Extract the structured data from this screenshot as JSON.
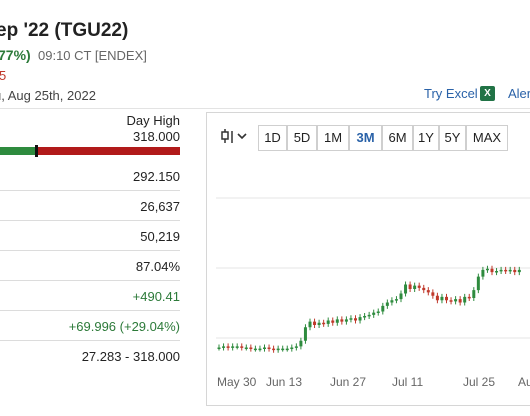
{
  "header": {
    "title": "ep '22 (TGU22)",
    "change_pct": "77%)",
    "time": "09:10 CT [ENDEX]",
    "line3": "5",
    "date": "u, Aug 25th, 2022"
  },
  "links": {
    "try_excel": "Try Excel",
    "alerts": "Aler",
    "excel_icon_text": "X"
  },
  "stats": {
    "day_high_label": "Day High",
    "day_high_value": "318.000",
    "rows": [
      {
        "value": "292.150",
        "color": "default"
      },
      {
        "value": "26,637",
        "color": "default"
      },
      {
        "value": "50,219",
        "color": "default"
      },
      {
        "value": "87.04%",
        "color": "default"
      },
      {
        "value": "+490.41",
        "color": "green"
      },
      {
        "value": "+69.996 (+29.04%)",
        "color": "green"
      },
      {
        "value": "27.283 - 318.000",
        "color": "default"
      }
    ]
  },
  "toolbar": {
    "chart_type_icon": "candlestick-icon",
    "ranges": [
      "1D",
      "5D",
      "1M",
      "3M",
      "6M",
      "1Y",
      "5Y",
      "MAX"
    ],
    "active_range": "3M"
  },
  "chart_data": {
    "type": "candlestick",
    "x_tick_labels": [
      "May 30",
      "Jun 13",
      "Jun 27",
      "Jul 11",
      "Jul 25",
      "Au"
    ],
    "grid": true,
    "colors": {
      "up": "#2e8b3e",
      "down": "#c0392b"
    },
    "candles_approx_close": [
      0.04,
      0.05,
      0.04,
      0.05,
      0.05,
      0.04,
      0.04,
      0.03,
      0.03,
      0.03,
      0.04,
      0.03,
      0.02,
      0.03,
      0.03,
      0.03,
      0.04,
      0.05,
      0.1,
      0.22,
      0.27,
      0.24,
      0.26,
      0.25,
      0.28,
      0.26,
      0.29,
      0.27,
      0.29,
      0.3,
      0.28,
      0.31,
      0.32,
      0.33,
      0.35,
      0.36,
      0.41,
      0.44,
      0.46,
      0.47,
      0.52,
      0.6,
      0.56,
      0.59,
      0.57,
      0.55,
      0.53,
      0.5,
      0.46,
      0.49,
      0.46,
      0.45,
      0.47,
      0.44,
      0.49,
      0.48,
      0.55,
      0.67,
      0.73,
      0.74,
      0.71,
      0.72,
      0.73,
      0.72,
      0.73,
      0.71,
      0.73
    ]
  },
  "colors": {
    "accent": "#2a62a8",
    "up": "#2c7a39",
    "down": "#b11a1a"
  }
}
